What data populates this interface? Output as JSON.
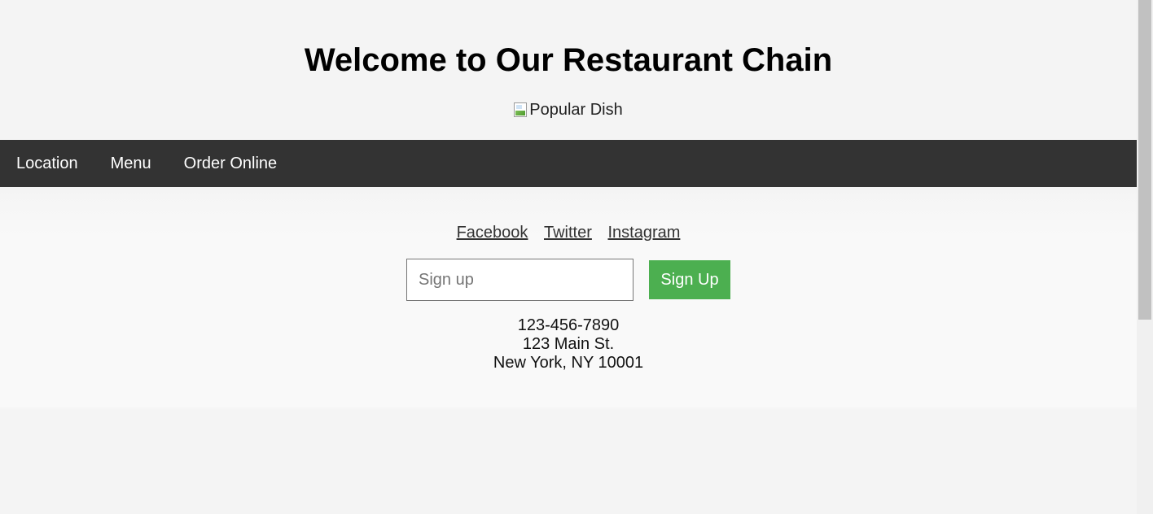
{
  "header": {
    "title": "Welcome to Our Restaurant Chain",
    "image_alt": "Popular Dish"
  },
  "nav": {
    "items": [
      {
        "label": "Location"
      },
      {
        "label": "Menu"
      },
      {
        "label": "Order Online"
      }
    ]
  },
  "footer": {
    "social": [
      {
        "label": "Facebook"
      },
      {
        "label": "Twitter"
      },
      {
        "label": "Instagram"
      }
    ],
    "signup": {
      "placeholder": "Sign up",
      "value": "",
      "button_label": "Sign Up"
    },
    "contact": {
      "phone": "123-456-7890",
      "street": "123 Main St.",
      "city": "New York, NY 10001"
    }
  },
  "colors": {
    "nav_background": "#333333",
    "signup_button": "#4caf50",
    "page_background": "#f4f4f4"
  },
  "icons": {
    "image_placeholder": "broken-image-icon"
  }
}
